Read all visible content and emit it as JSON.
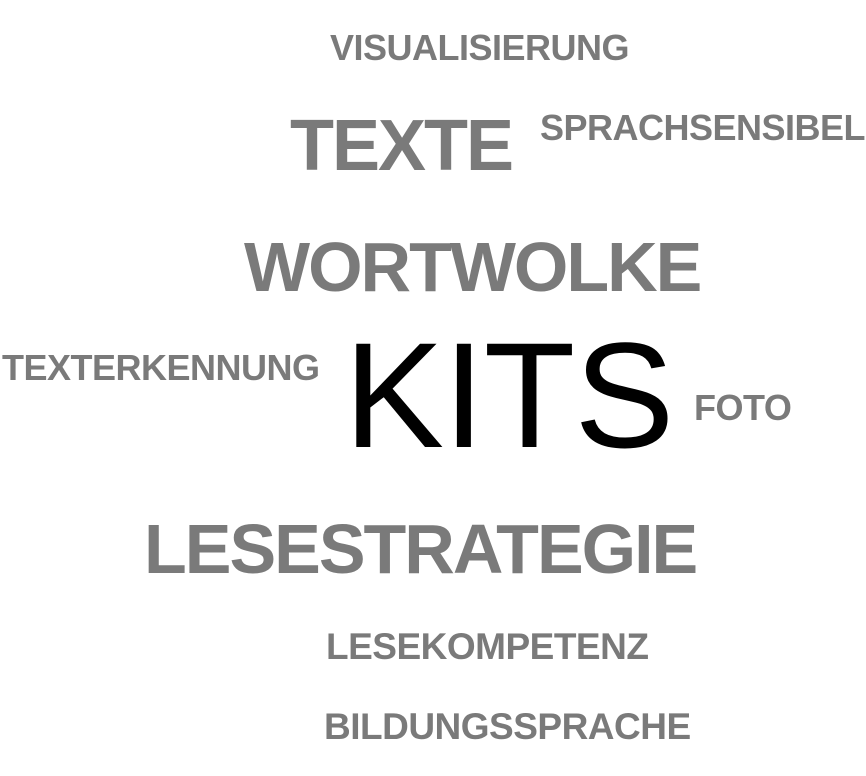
{
  "word_cloud": {
    "words": {
      "visualisierung": "VISUALISIERUNG",
      "texte": "TEXTE",
      "sprachsensibel": "SPRACHSENSIBEL",
      "wortwolke": "WORTWOLKE",
      "texterkennung": "TEXTERKENNUNG",
      "kits": "KITS",
      "foto": "FOTO",
      "lesestrategie": "LESESTRATEGIE",
      "lesekompetenz": "LESEKOMPETENZ",
      "bildungssprache": "BILDUNGSSPRACHE"
    },
    "colors": {
      "main_word": "#000000",
      "secondary_words": "#7a7a7a",
      "background": "#ffffff"
    }
  }
}
